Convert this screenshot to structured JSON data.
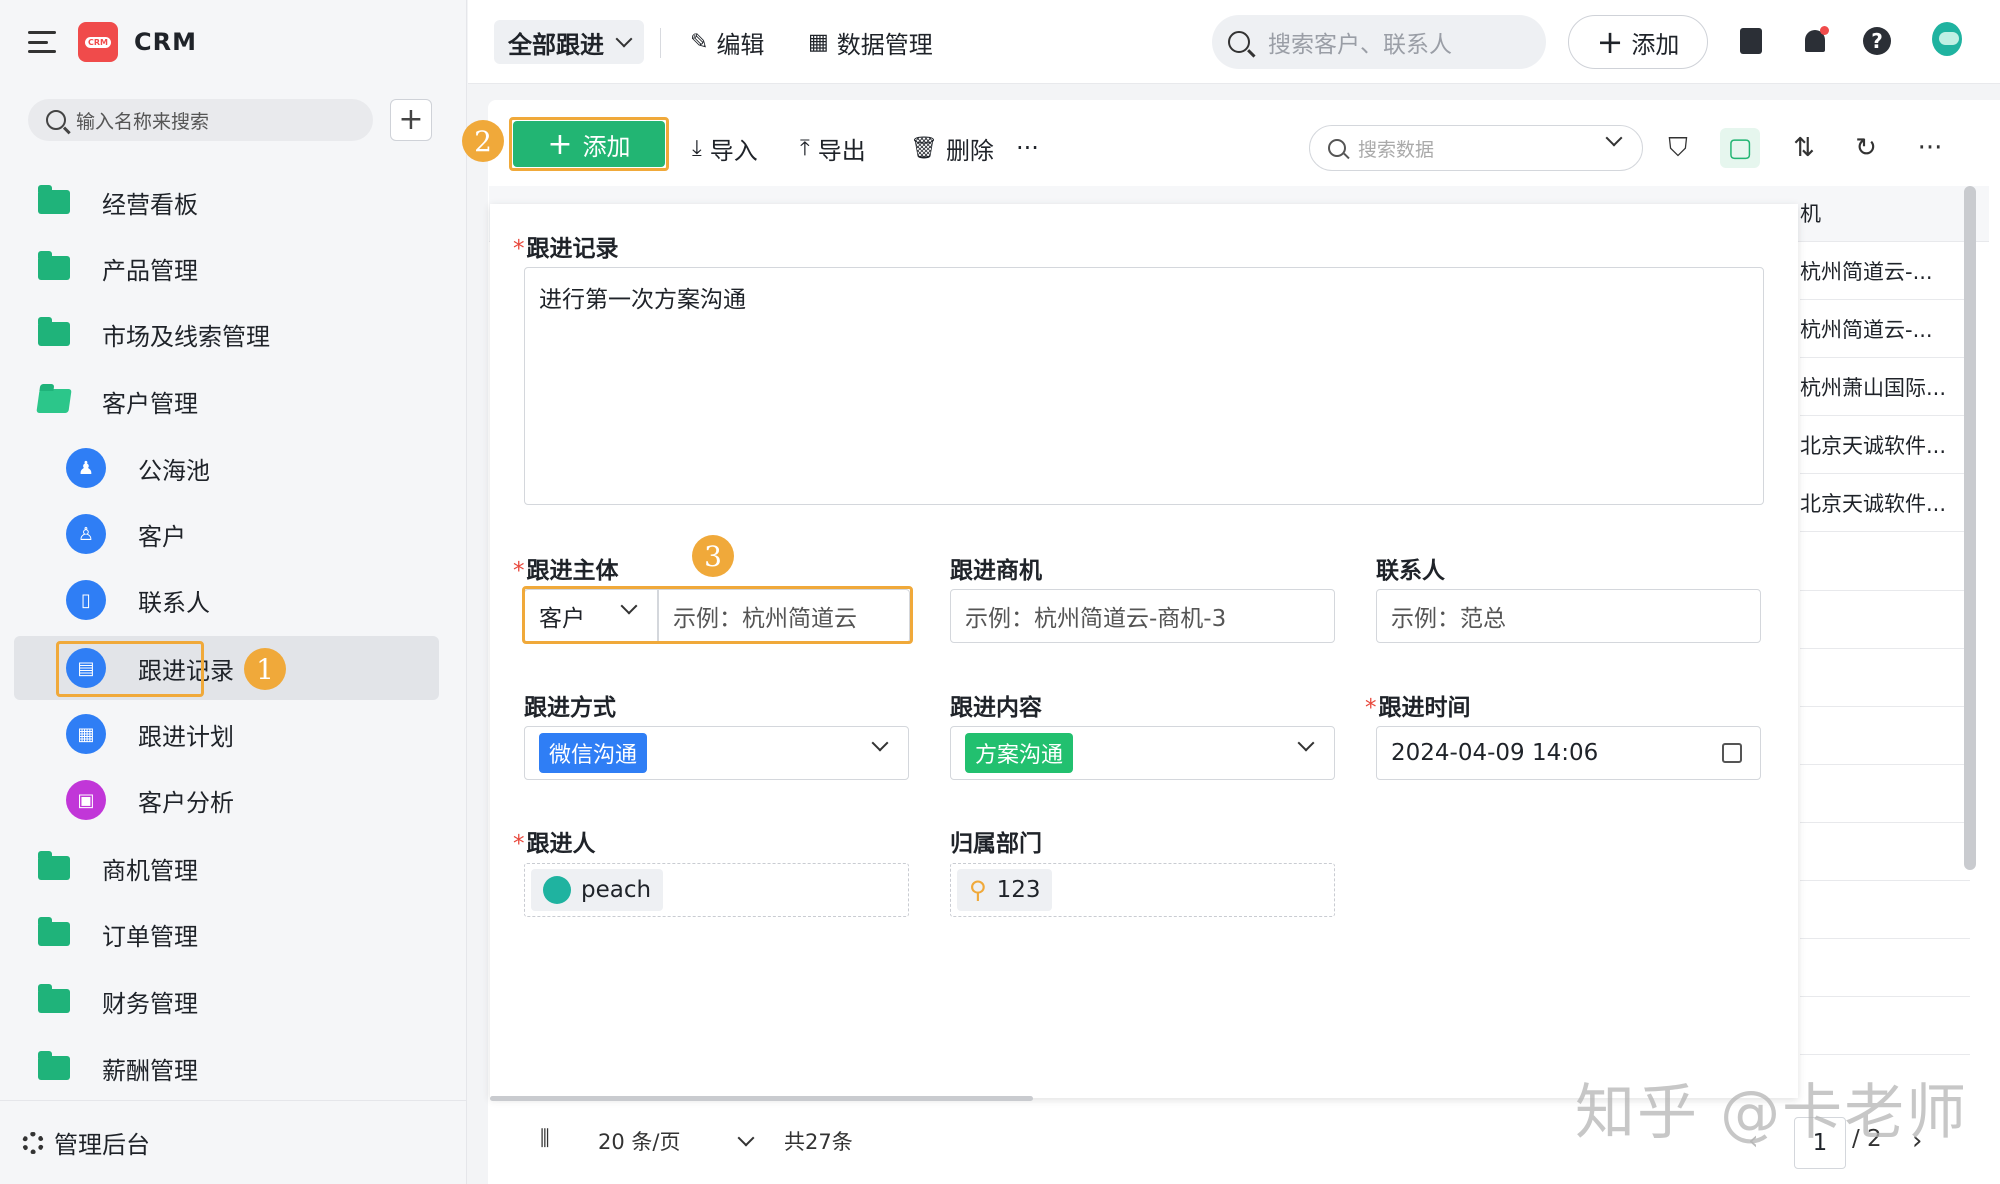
{
  "app": {
    "name": "CRM",
    "logo_text": "CRM"
  },
  "sidebar": {
    "search_placeholder": "输入名称来搜索",
    "add_label": "+",
    "items": [
      {
        "label": "经营看板"
      },
      {
        "label": "产品管理"
      },
      {
        "label": "市场及线索管理"
      },
      {
        "label": "客户管理"
      },
      {
        "label": "公海池"
      },
      {
        "label": "客户"
      },
      {
        "label": "联系人"
      },
      {
        "label": "跟进记录"
      },
      {
        "label": "跟进计划"
      },
      {
        "label": "客户分析"
      },
      {
        "label": "商机管理"
      },
      {
        "label": "订单管理"
      },
      {
        "label": "财务管理"
      },
      {
        "label": "薪酬管理"
      }
    ],
    "footer_label": "管理后台"
  },
  "topbar": {
    "view_label": "全部跟进",
    "edit_label": "编辑",
    "data_manage_label": "数据管理",
    "search_placeholder": "搜索客户、联系人",
    "add_label": "添加"
  },
  "toolbar": {
    "add_label": "添加",
    "import_label": "导入",
    "export_label": "导出",
    "delete_label": "删除",
    "more_label": "···",
    "search_placeholder": "搜索数据"
  },
  "annotations": {
    "badge1": "1",
    "badge2": "2",
    "badge3": "3"
  },
  "table": {
    "partial_header": "机",
    "rows": [
      "杭州简道云-...",
      "杭州简道云-...",
      "杭州萧山国际...",
      "北京天诚软件...",
      "北京天诚软件..."
    ]
  },
  "form": {
    "record_label": "跟进记录",
    "record_value": "进行第一次方案沟通",
    "subject_label": "跟进主体",
    "subject_type": "客户",
    "subject_placeholder": "示例：杭州简道云",
    "opportunity_label": "跟进商机",
    "opportunity_placeholder": "示例：杭州简道云-商机-3",
    "contact_label": "联系人",
    "contact_placeholder": "示例：范总",
    "method_label": "跟进方式",
    "method_value": "微信沟通",
    "content_label": "跟进内容",
    "content_value": "方案沟通",
    "time_label": "跟进时间",
    "time_value": "2024-04-09 14:06",
    "owner_label": "跟进人",
    "owner_value": "peach",
    "dept_label": "归属部门",
    "dept_value": "123"
  },
  "pager": {
    "page_size": "20 条/页",
    "total": "共27条",
    "current_page": "1",
    "total_pages": "/ 2"
  },
  "watermark": "知乎 @卡老师",
  "colors": {
    "primary": "#22b573",
    "highlight": "#f0a93a",
    "required": "#e8483c"
  }
}
